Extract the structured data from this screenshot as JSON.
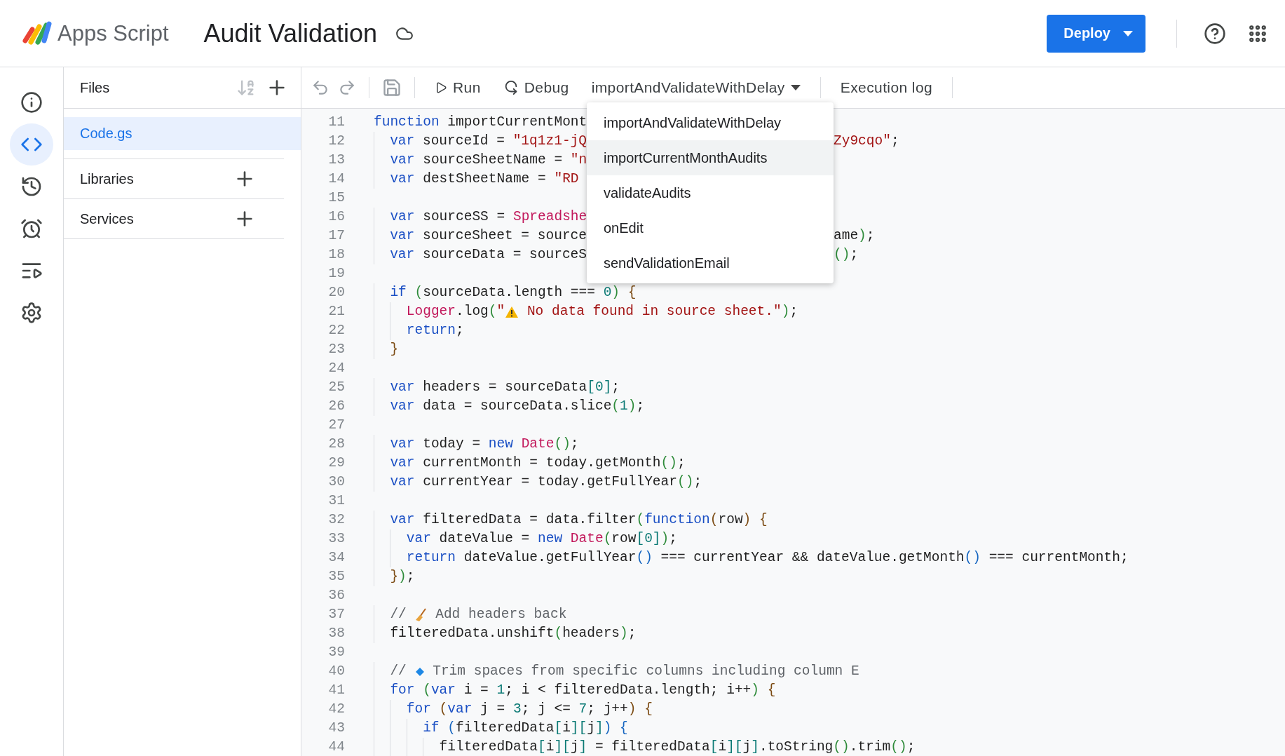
{
  "header": {
    "app_name": "Apps Script",
    "project_title": "Audit Validation",
    "deploy": "Deploy"
  },
  "rail": [
    {
      "kind": "info",
      "selected": false
    },
    {
      "kind": "code",
      "selected": true
    },
    {
      "kind": "history",
      "selected": false
    },
    {
      "kind": "triggers",
      "selected": false
    },
    {
      "kind": "executions",
      "selected": false
    },
    {
      "kind": "settings",
      "selected": false
    }
  ],
  "files_panel": {
    "title": "Files",
    "files": [
      {
        "name": "Code.gs",
        "selected": true
      }
    ],
    "sections": [
      {
        "label": "Libraries"
      },
      {
        "label": "Services"
      }
    ]
  },
  "toolbar": {
    "run": "Run",
    "debug": "Debug",
    "function": "importAndValidateWithDelay",
    "execution_log": "Execution log"
  },
  "function_menu": [
    {
      "label": "importAndValidateWithDelay",
      "selected": false
    },
    {
      "label": "importCurrentMonthAudits",
      "selected": true
    },
    {
      "label": "validateAudits",
      "selected": false
    },
    {
      "label": "onEdit",
      "selected": false
    },
    {
      "label": "sendValidationEmail",
      "selected": false
    }
  ],
  "editor": {
    "lines": [
      {
        "number": "11",
        "code": [
          {
            "kind": "kw",
            "text": "function"
          },
          {
            "kind": "p",
            "text": " importCurrentMont"
          }
        ]
      },
      {
        "number": "12",
        "code": [
          {
            "kind": "kw",
            "text": "  var"
          },
          {
            "kind": "p",
            "text": " sourceId = "
          },
          {
            "kind": "str",
            "text": "\"1q1z1-jQ"
          }
        ],
        "code_right": [
          {
            "kind": "str",
            "text": "Zy9cqo\""
          },
          {
            "kind": "p",
            "text": ";"
          }
        ]
      },
      {
        "number": "13",
        "code": [
          {
            "kind": "kw",
            "text": "  var"
          },
          {
            "kind": "p",
            "text": " sourceSheetName = "
          },
          {
            "kind": "str",
            "text": "\"n"
          }
        ]
      },
      {
        "number": "14",
        "code": [
          {
            "kind": "kw",
            "text": "  var"
          },
          {
            "kind": "p",
            "text": " destSheetName = "
          },
          {
            "kind": "str",
            "text": "\"RD"
          }
        ]
      },
      {
        "number": "15"
      },
      {
        "number": "16",
        "code": [
          {
            "kind": "kw",
            "text": "  var"
          },
          {
            "kind": "p",
            "text": " sourceSS = "
          },
          {
            "kind": "fn",
            "text": "Spreadshe"
          }
        ]
      },
      {
        "number": "17",
        "code": [
          {
            "kind": "kw",
            "text": "  var"
          },
          {
            "kind": "p",
            "text": " sourceSheet = source"
          }
        ],
        "code_right": [
          {
            "kind": "p",
            "text": "ame"
          },
          {
            "kind": "br",
            "text": ")"
          },
          {
            "kind": "p",
            "text": ";"
          }
        ]
      },
      {
        "number": "18",
        "code": [
          {
            "kind": "kw",
            "text": "  var"
          },
          {
            "kind": "p",
            "text": " sourceData = sourceS"
          }
        ],
        "code_right": [
          {
            "kind": "br",
            "text": "()"
          },
          {
            "kind": "p",
            "text": ";"
          }
        ]
      },
      {
        "number": "19"
      },
      {
        "number": "20",
        "code": [
          {
            "kind": "kw",
            "text": "  if"
          },
          {
            "kind": "br",
            "text": " ("
          },
          {
            "kind": "p",
            "text": "sourceData.length === "
          },
          {
            "kind": "num",
            "text": "0"
          },
          {
            "kind": "br",
            "text": ")"
          },
          {
            "kind": "brace",
            "text": " {"
          }
        ]
      },
      {
        "number": "21",
        "code": [
          {
            "kind": "fn",
            "text": "    Logger"
          },
          {
            "kind": "p",
            "text": ".log"
          },
          {
            "kind": "br",
            "text": "("
          },
          {
            "kind": "str",
            "text": "\""
          },
          {
            "kind": "warn"
          },
          {
            "kind": "str",
            "text": " No data found in source sheet.\""
          },
          {
            "kind": "br",
            "text": ")"
          },
          {
            "kind": "p",
            "text": ";"
          }
        ]
      },
      {
        "number": "22",
        "code": [
          {
            "kind": "kw",
            "text": "    return"
          },
          {
            "kind": "p",
            "text": ";"
          }
        ]
      },
      {
        "number": "23",
        "code": [
          {
            "kind": "brace",
            "text": "  }"
          }
        ]
      },
      {
        "number": "24"
      },
      {
        "number": "25",
        "code": [
          {
            "kind": "kw",
            "text": "  var"
          },
          {
            "kind": "p",
            "text": " headers = sourceData"
          },
          {
            "kind": "sq",
            "text": "["
          },
          {
            "kind": "num",
            "text": "0"
          },
          {
            "kind": "sq",
            "text": "]"
          },
          {
            "kind": "p",
            "text": ";"
          }
        ]
      },
      {
        "number": "26",
        "code": [
          {
            "kind": "kw",
            "text": "  var"
          },
          {
            "kind": "p",
            "text": " data = sourceData.slice"
          },
          {
            "kind": "br",
            "text": "("
          },
          {
            "kind": "num",
            "text": "1"
          },
          {
            "kind": "br",
            "text": ")"
          },
          {
            "kind": "p",
            "text": ";"
          }
        ]
      },
      {
        "number": "27"
      },
      {
        "number": "28",
        "code": [
          {
            "kind": "kw",
            "text": "  var"
          },
          {
            "kind": "p",
            "text": " today = "
          },
          {
            "kind": "kw",
            "text": "new"
          },
          {
            "kind": "fn",
            "text": " Date"
          },
          {
            "kind": "br",
            "text": "()"
          },
          {
            "kind": "p",
            "text": ";"
          }
        ]
      },
      {
        "number": "29",
        "code": [
          {
            "kind": "kw",
            "text": "  var"
          },
          {
            "kind": "p",
            "text": " currentMonth = today.getMonth"
          },
          {
            "kind": "br",
            "text": "()"
          },
          {
            "kind": "p",
            "text": ";"
          }
        ]
      },
      {
        "number": "30",
        "code": [
          {
            "kind": "kw",
            "text": "  var"
          },
          {
            "kind": "p",
            "text": " currentYear = today.getFullYear"
          },
          {
            "kind": "br",
            "text": "()"
          },
          {
            "kind": "p",
            "text": ";"
          }
        ]
      },
      {
        "number": "31"
      },
      {
        "number": "32",
        "code": [
          {
            "kind": "kw",
            "text": "  var"
          },
          {
            "kind": "p",
            "text": " filteredData = data.filter"
          },
          {
            "kind": "br",
            "text": "("
          },
          {
            "kind": "kw",
            "text": "function"
          },
          {
            "kind": "brace",
            "text": "("
          },
          {
            "kind": "p",
            "text": "row"
          },
          {
            "kind": "brace",
            "text": ") {"
          }
        ]
      },
      {
        "number": "33",
        "code": [
          {
            "kind": "kw",
            "text": "    var"
          },
          {
            "kind": "p",
            "text": " dateValue = "
          },
          {
            "kind": "kw",
            "text": "new"
          },
          {
            "kind": "fn",
            "text": " Date"
          },
          {
            "kind": "br",
            "text": "("
          },
          {
            "kind": "p",
            "text": "row"
          },
          {
            "kind": "sq",
            "text": "["
          },
          {
            "kind": "num",
            "text": "0"
          },
          {
            "kind": "sq",
            "text": "]"
          },
          {
            "kind": "br",
            "text": ")"
          },
          {
            "kind": "p",
            "text": ";"
          }
        ]
      },
      {
        "number": "34",
        "code": [
          {
            "kind": "kw",
            "text": "    return"
          },
          {
            "kind": "p",
            "text": " dateValue.getFullYear"
          },
          {
            "kind": "bl",
            "text": "()"
          },
          {
            "kind": "p",
            "text": " === currentYear && dateValue.getMonth"
          },
          {
            "kind": "bl",
            "text": "()"
          },
          {
            "kind": "p",
            "text": " === currentMonth;"
          }
        ]
      },
      {
        "number": "35",
        "code": [
          {
            "kind": "brace",
            "text": "  }"
          },
          {
            "kind": "br",
            "text": ")"
          },
          {
            "kind": "p",
            "text": ";"
          }
        ]
      },
      {
        "number": "36"
      },
      {
        "number": "37",
        "code": [
          {
            "kind": "cm",
            "text": "  // "
          },
          {
            "kind": "broom"
          },
          {
            "kind": "cm",
            "text": " Add headers back"
          }
        ]
      },
      {
        "number": "38",
        "code": [
          {
            "kind": "p",
            "text": "  filteredData.unshift"
          },
          {
            "kind": "br",
            "text": "("
          },
          {
            "kind": "p",
            "text": "headers"
          },
          {
            "kind": "br",
            "text": ")"
          },
          {
            "kind": "p",
            "text": ";"
          }
        ]
      },
      {
        "number": "39"
      },
      {
        "number": "40",
        "code": [
          {
            "kind": "cm",
            "text": "  // "
          },
          {
            "kind": "diamond"
          },
          {
            "kind": "cm",
            "text": " Trim spaces from specific columns including column E"
          }
        ]
      },
      {
        "number": "41",
        "code": [
          {
            "kind": "kw",
            "text": "  for"
          },
          {
            "kind": "br",
            "text": " ("
          },
          {
            "kind": "kw",
            "text": "var"
          },
          {
            "kind": "p",
            "text": " i = "
          },
          {
            "kind": "num",
            "text": "1"
          },
          {
            "kind": "p",
            "text": "; i < filteredData.length; i++"
          },
          {
            "kind": "br",
            "text": ")"
          },
          {
            "kind": "brace",
            "text": " {"
          }
        ]
      },
      {
        "number": "42",
        "code": [
          {
            "kind": "kw",
            "text": "    for"
          },
          {
            "kind": "brace",
            "text": " ("
          },
          {
            "kind": "kw",
            "text": "var"
          },
          {
            "kind": "p",
            "text": " j = "
          },
          {
            "kind": "num",
            "text": "3"
          },
          {
            "kind": "p",
            "text": "; j <= "
          },
          {
            "kind": "num",
            "text": "7"
          },
          {
            "kind": "p",
            "text": "; j++"
          },
          {
            "kind": "brace",
            "text": ") {"
          }
        ]
      },
      {
        "number": "43",
        "code": [
          {
            "kind": "kw",
            "text": "      if"
          },
          {
            "kind": "bl",
            "text": " ("
          },
          {
            "kind": "p",
            "text": "filteredData"
          },
          {
            "kind": "sq",
            "text": "["
          },
          {
            "kind": "p",
            "text": "i"
          },
          {
            "kind": "sq",
            "text": "]["
          },
          {
            "kind": "p",
            "text": "j"
          },
          {
            "kind": "sq",
            "text": "]"
          },
          {
            "kind": "bl",
            "text": ") {"
          }
        ]
      },
      {
        "number": "44",
        "code": [
          {
            "kind": "p",
            "text": "        filteredData"
          },
          {
            "kind": "sq",
            "text": "["
          },
          {
            "kind": "p",
            "text": "i"
          },
          {
            "kind": "sq",
            "text": "]["
          },
          {
            "kind": "p",
            "text": "j"
          },
          {
            "kind": "sq",
            "text": "]"
          },
          {
            "kind": "p",
            "text": " = filteredData"
          },
          {
            "kind": "sq",
            "text": "["
          },
          {
            "kind": "p",
            "text": "i"
          },
          {
            "kind": "sq",
            "text": "]["
          },
          {
            "kind": "p",
            "text": "j"
          },
          {
            "kind": "sq",
            "text": "]"
          },
          {
            "kind": "p",
            "text": ".toString"
          },
          {
            "kind": "br",
            "text": "()"
          },
          {
            "kind": "p",
            "text": ".trim"
          },
          {
            "kind": "br",
            "text": "()"
          },
          {
            "kind": "p",
            "text": ";"
          }
        ]
      }
    ]
  }
}
